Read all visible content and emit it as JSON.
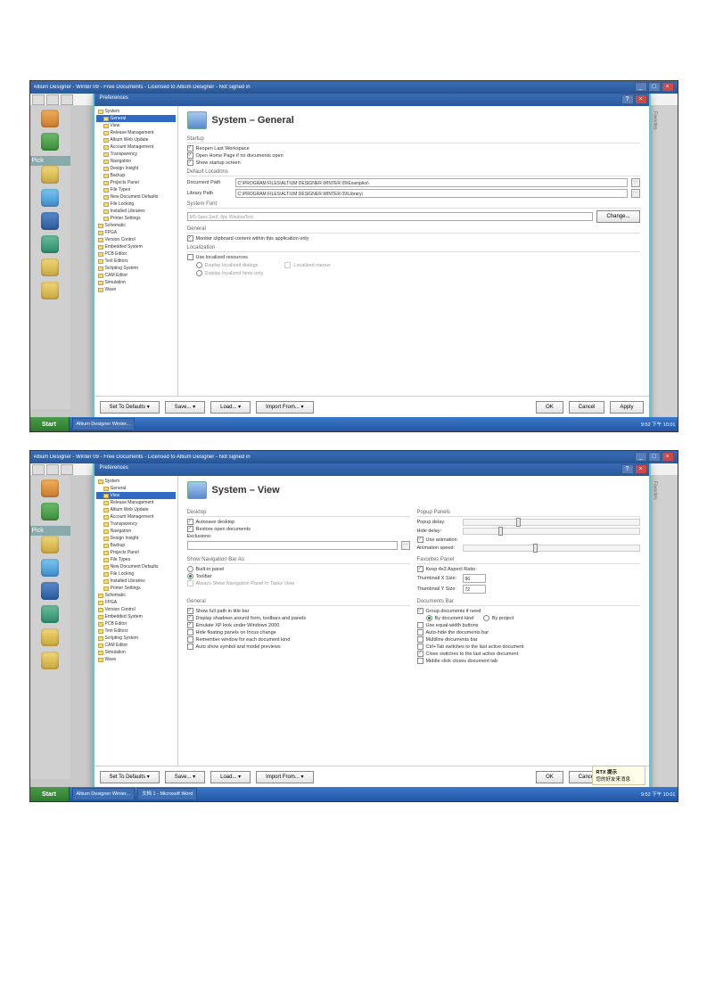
{
  "app_title": "Altium Designer - Winter 09 - Free Documents - Licensed to Altium Designer - Not signed in",
  "pref_caption": "Preferences",
  "start_label": "Start",
  "task_apps": [
    "Altium Designer Winter...",
    "文档 1 - Microsoft Word"
  ],
  "tray_time": "9:52 下午 10:01",
  "pick_label": "Pick",
  "tree": [
    {
      "l": 1,
      "t": "System",
      "sel": false
    },
    {
      "l": 2,
      "t": "General",
      "sel": "A"
    },
    {
      "l": 2,
      "t": "View",
      "sel": "B"
    },
    {
      "l": 2,
      "t": "Release Management"
    },
    {
      "l": 2,
      "t": "Altium Web Update"
    },
    {
      "l": 2,
      "t": "Account Management"
    },
    {
      "l": 2,
      "t": "Transparency"
    },
    {
      "l": 2,
      "t": "Navigation"
    },
    {
      "l": 2,
      "t": "Design Insight"
    },
    {
      "l": 2,
      "t": "Backup"
    },
    {
      "l": 2,
      "t": "Projects Panel"
    },
    {
      "l": 2,
      "t": "File Types"
    },
    {
      "l": 2,
      "t": "New Document Defaults"
    },
    {
      "l": 2,
      "t": "File Locking"
    },
    {
      "l": 2,
      "t": "Installed Libraries"
    },
    {
      "l": 2,
      "t": "Printer Settings"
    },
    {
      "l": 1,
      "t": "Schematic"
    },
    {
      "l": 1,
      "t": "FPGA"
    },
    {
      "l": 1,
      "t": "Version Control"
    },
    {
      "l": 1,
      "t": "Embedded System"
    },
    {
      "l": 1,
      "t": "PCB Editor"
    },
    {
      "l": 1,
      "t": "Text Editors"
    },
    {
      "l": 1,
      "t": "Scripting System"
    },
    {
      "l": 1,
      "t": "CAM Editor"
    },
    {
      "l": 1,
      "t": "Simulation"
    },
    {
      "l": 1,
      "t": "Wave"
    }
  ],
  "general": {
    "heading": "System – General",
    "grp_startup": "Startup",
    "c1": "Reopen Last Workspace",
    "c2": "Open Home Page if no documents open",
    "c3": "Show startup screen",
    "grp_defloc": "Default Locations",
    "doc_path_lbl": "Document Path",
    "doc_path_val": "C:\\PROGRAM FILES\\ALTIUM DESIGNER WINTER 09\\Examples\\",
    "lib_path_lbl": "Library Path",
    "lib_path_val": "C:\\PROGRAM FILES\\ALTIUM DESIGNER WINTER 09\\Library\\",
    "grp_sysfont": "System Font",
    "sysfont_val": "MS Sans Serif, 8pt, WindowText",
    "change_btn": "Change...",
    "grp_general": "General",
    "c_monitor": "Monitor clipboard content within this application only",
    "grp_local": "Localization",
    "c_uselocal": "Use localized resources",
    "r_dialogs": "Display localized dialogs",
    "r_localized_menus": "Localized menus",
    "r_hints": "Display localized hints only"
  },
  "view": {
    "heading": "System – View",
    "grp_desktop": "Desktop",
    "c_autosave": "Autosave desktop",
    "c_restore": "Restore open documents",
    "excl_lbl": "Exclusions:",
    "grp_popup": "Popup Panels",
    "s_delay": "Popup delay:",
    "s_hide": "Hide delay:",
    "c_anim": "Use animation",
    "s_speed": "Animation speed:",
    "grp_shownav": "Show Navigation Bar As",
    "r_builtin": "Built-in panel",
    "r_toolbar": "Toolbar",
    "c_always": "Always Show Navigation Panel In Tasks View",
    "grp_favpanel": "Favorites Panel",
    "c_keepratio": "Keep 4x3 Aspect Ratio",
    "thumb_x": "Thumbnail X Size:",
    "thumb_y": "Thumbnail Y Size:",
    "tx_val": "96",
    "ty_val": "72",
    "grp_general": "General",
    "c_fullpath": "Show full path in title bar",
    "c_chan": "Display shadows around form, toolbars and panels",
    "c_emulate": "Emulate XP look under Windows 2000",
    "c_hidefloat": "Hide floating panels on focus change",
    "c_remember": "Remember window for each document kind",
    "c_autoshow": "Auto show symbol and model previews",
    "grp_docbar": "Documents Bar",
    "c_group": "Group documents if need",
    "r_bykind": "By document kind",
    "r_byprj": "By project",
    "c_equal": "Use equal-width buttons",
    "c_autohide": "Auto-hide the documents bar",
    "c_multiline": "Multiline documents bar",
    "c_ctrltab": "Ctrl+Tab switches to the last active document",
    "c_close": "Close switches to the last active document",
    "c_middle": "Middle click closes document tab"
  },
  "buttons": {
    "set_def": "Set To Defaults  ▾",
    "save": "Save...  ▾",
    "load": "Load...  ▾",
    "import": "Import From...  ▾",
    "ok": "OK",
    "cancel": "Cancel",
    "apply": "Apply"
  },
  "tooltip": {
    "t": "RTX 提示",
    "b": "您的好友来消息"
  }
}
